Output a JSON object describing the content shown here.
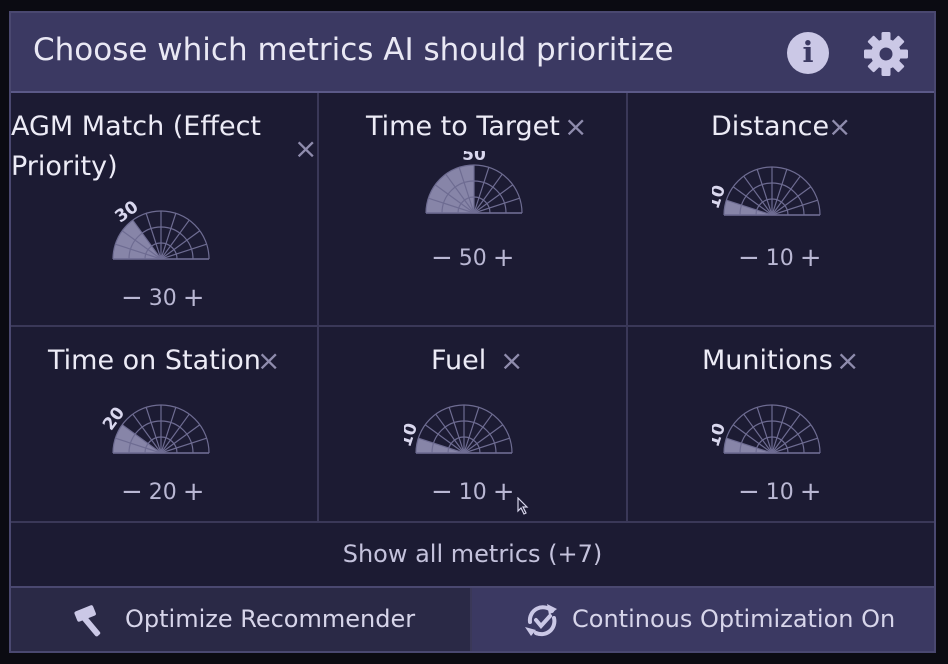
{
  "header": {
    "title": "Choose which metrics AI should prioritize",
    "info_icon": "info-icon",
    "settings_icon": "gear-icon"
  },
  "metrics": [
    {
      "label": "AGM Match (Effect",
      "label2": "Priority)",
      "value": "30",
      "level": 30
    },
    {
      "label": "Time to Target",
      "value": "50",
      "level": 50
    },
    {
      "label": "Distance",
      "value": "10",
      "level": 10
    },
    {
      "label": "Time on Station",
      "value": "20",
      "level": 20
    },
    {
      "label": "Fuel",
      "value": "10",
      "level": 10
    },
    {
      "label": "Munitions",
      "value": "10",
      "level": 10
    }
  ],
  "show_all": {
    "label": "Show all metrics (+7)"
  },
  "footer": {
    "optimize_label": "Optimize Recommender",
    "continuous_label": "Continous Optimization On"
  },
  "colors": {
    "panel": "#1c1b33",
    "header": "#3b3962",
    "gauge_fill": "#9a98bd",
    "text": "#ecebf6"
  }
}
